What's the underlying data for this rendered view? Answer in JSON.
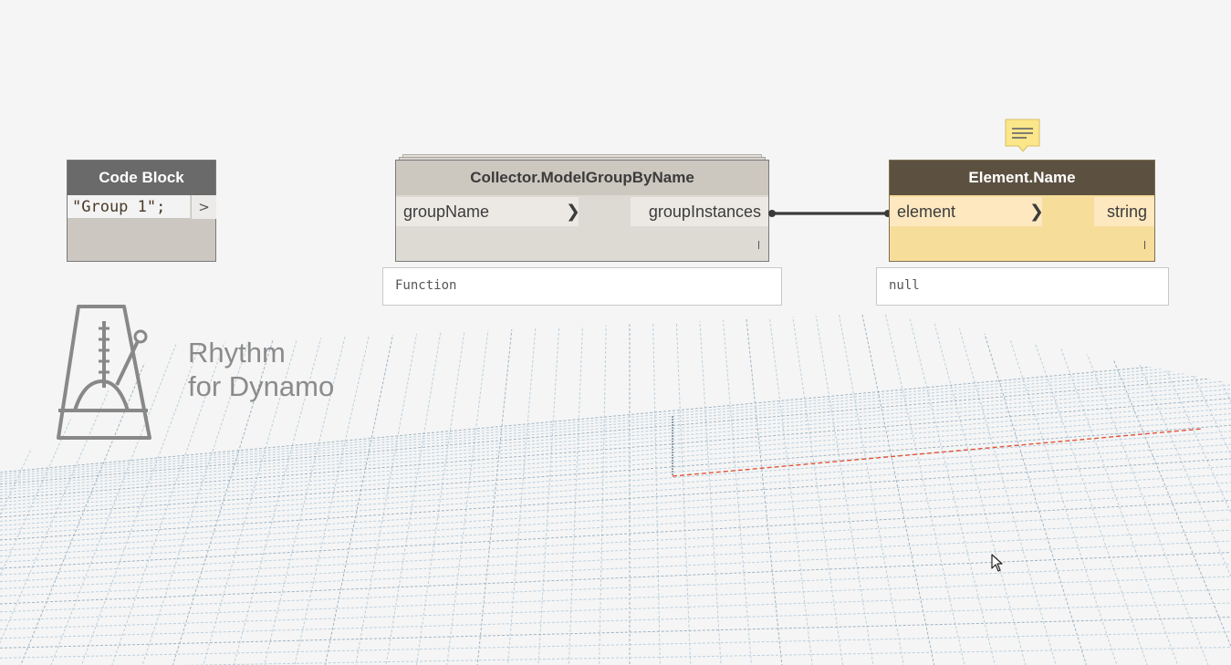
{
  "code_block": {
    "title": "Code Block",
    "code": "\"Group 1\";",
    "output_marker": ">"
  },
  "collector_node": {
    "title": "Collector.ModelGroupByName",
    "input_port": "groupName",
    "output_port": "groupInstances",
    "preview": "Function"
  },
  "element_name_node": {
    "title": "Element.Name",
    "input_port": "element",
    "output_port": "string",
    "preview": "null"
  },
  "package_logo": {
    "line1": "Rhythm",
    "line2": "for Dynamo"
  },
  "colors": {
    "node_header_gray": "#6a6a6a",
    "node_header_dark": "#5c5141",
    "node_body": "#ddd9d3",
    "selected_body": "#f7dd9a",
    "x_axis_red": "#e0553a",
    "grid_lines": "#bcd0de",
    "logo_gray": "#888888"
  }
}
